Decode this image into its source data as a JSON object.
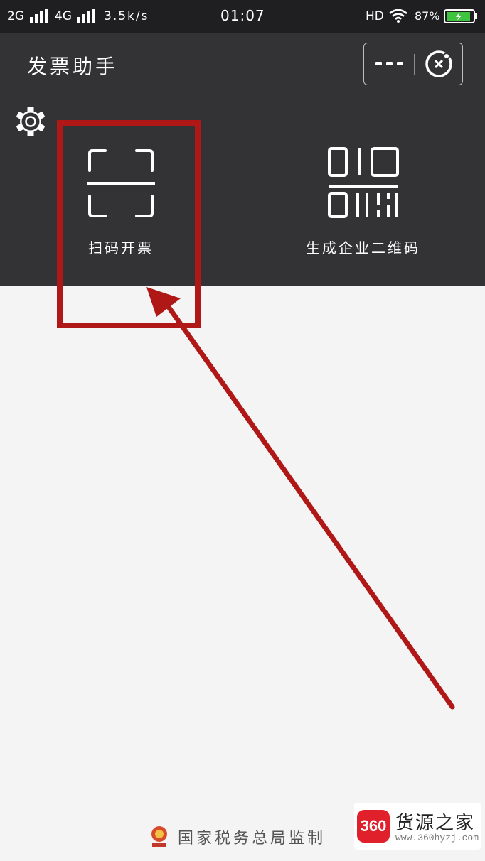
{
  "status_bar": {
    "network_2g": "2G",
    "network_4g": "4G",
    "speed": "3.5k/s",
    "time": "01:07",
    "hd": "HD",
    "battery": "87%"
  },
  "header": {
    "title": "发票助手"
  },
  "features": [
    {
      "label": "扫码开票"
    },
    {
      "label": "生成企业二维码"
    }
  ],
  "footer": {
    "text": "国家税务总局监制"
  },
  "watermark": {
    "badge": "360",
    "name": "货源之家",
    "url": "www.360hyzj.com"
  },
  "colors": {
    "header_bg": "#333336",
    "status_bg": "#1f1f22",
    "body_bg": "#f4f4f4",
    "annotation_red": "#b01818",
    "battery_green": "#3ec43e"
  }
}
